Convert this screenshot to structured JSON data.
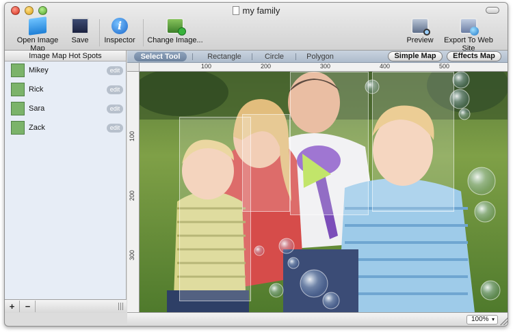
{
  "window": {
    "title": "my family"
  },
  "toolbar": {
    "open_label": "Open Image Map",
    "save_label": "Save",
    "inspector_label": "Inspector",
    "change_image_label": "Change Image...",
    "preview_label": "Preview",
    "export_label": "Export To Web Site"
  },
  "sidebar": {
    "header": "Image Map Hot Spots",
    "items": [
      {
        "label": "Mikey",
        "edit": "edit"
      },
      {
        "label": "Rick",
        "edit": "edit"
      },
      {
        "label": "Sara",
        "edit": "edit"
      },
      {
        "label": "Zack",
        "edit": "edit"
      }
    ],
    "add_label": "+",
    "remove_label": "−"
  },
  "tools": {
    "select": "Select Tool",
    "rectangle": "Rectangle",
    "circle": "Circle",
    "polygon": "Polygon",
    "simple_map": "Simple Map",
    "effects_map": "Effects Map"
  },
  "rulers": {
    "top": [
      "100",
      "200",
      "300",
      "400",
      "500"
    ],
    "left": [
      "100",
      "200",
      "300"
    ]
  },
  "status": {
    "zoom": "100%",
    "zoom_arrow": "▾"
  },
  "colors": {
    "accent": "#6d829e",
    "sidebar_bg": "#e7edf6"
  },
  "icons": {
    "open": "open-map-icon",
    "save": "save-icon",
    "inspector": "info-icon",
    "change_image": "change-image-icon",
    "preview": "preview-icon",
    "export": "export-web-icon"
  }
}
